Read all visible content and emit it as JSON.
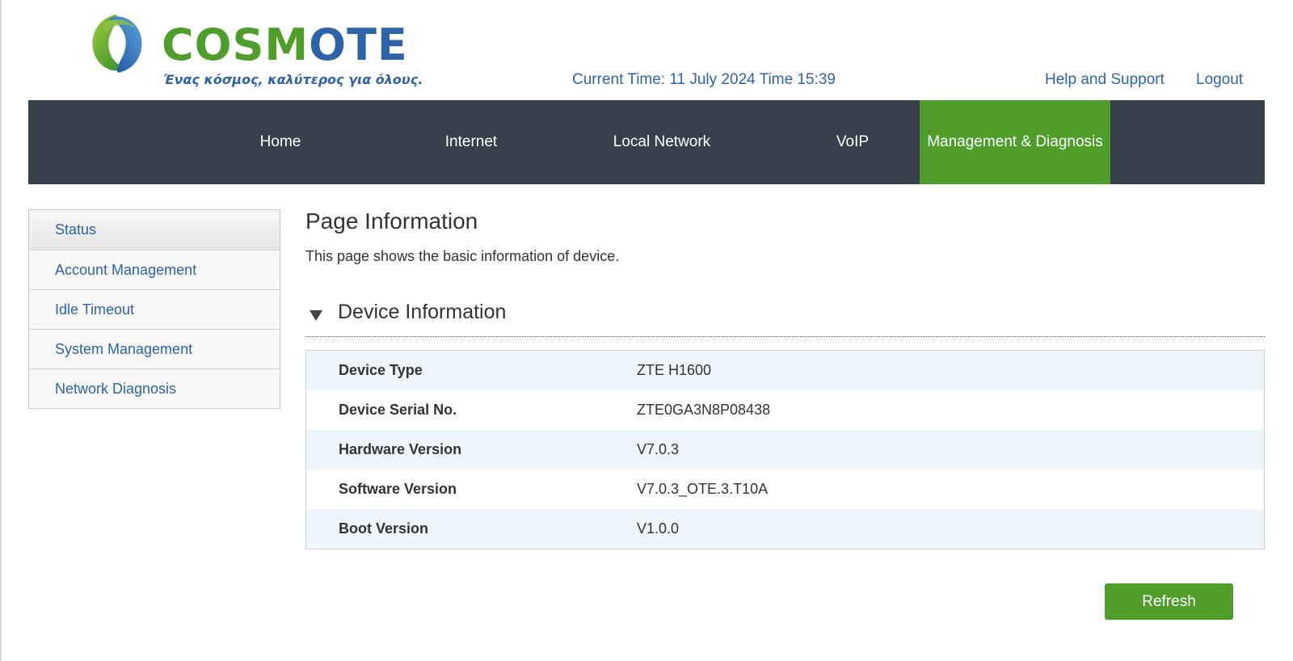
{
  "header": {
    "logo": {
      "brand_green": "COSM",
      "brand_blue": "OTE",
      "tagline": "Ένας κόσμος, καλύτερος για όλους."
    },
    "current_time": "Current Time: 11 July 2024 Time 15:39",
    "help_link": "Help and Support",
    "logout_link": "Logout"
  },
  "nav": {
    "items": [
      {
        "label": "Home"
      },
      {
        "label": "Internet"
      },
      {
        "label": "Local Network"
      },
      {
        "label": "VoIP"
      },
      {
        "label": "Management & Diagnosis"
      }
    ],
    "active": "Management & Diagnosis"
  },
  "sidebar": {
    "items": [
      {
        "label": "Status"
      },
      {
        "label": "Account Management"
      },
      {
        "label": "Idle Timeout"
      },
      {
        "label": "System Management"
      },
      {
        "label": "Network Diagnosis"
      }
    ],
    "active": "Status"
  },
  "main": {
    "title": "Page Information",
    "description": "This page shows the basic information of device.",
    "section": {
      "title": "Device Information",
      "expanded": true,
      "rows": [
        {
          "label": "Device Type",
          "value": "ZTE H1600"
        },
        {
          "label": "Device Serial No.",
          "value": "ZTE0GA3N8P08438"
        },
        {
          "label": "Hardware Version",
          "value": "V7.0.3"
        },
        {
          "label": "Software Version",
          "value": "V7.0.3_OTE.3.T10A"
        },
        {
          "label": "Boot Version",
          "value": "V1.0.0"
        }
      ]
    },
    "refresh_button": "Refresh"
  },
  "colors": {
    "brand_green": "#4f9e2b",
    "brand_blue": "#2e63a8",
    "nav_background": "#37414b",
    "table_stripe": "#eef6fc"
  }
}
